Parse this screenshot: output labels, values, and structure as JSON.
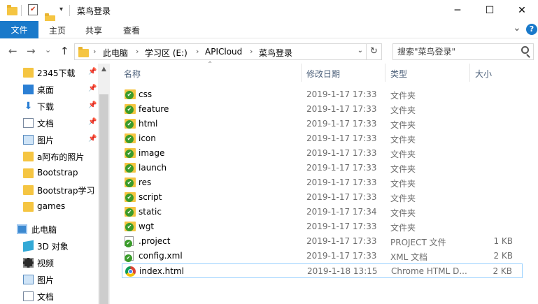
{
  "window": {
    "title": "菜鸟登录",
    "minimize": "─",
    "maximize": "☐",
    "close": "✕"
  },
  "ribbon": {
    "tabs": [
      "文件",
      "主页",
      "共享",
      "查看"
    ],
    "expand": "⌄",
    "help": "?"
  },
  "nav": {
    "back": "←",
    "forward": "→",
    "recent": "⌄",
    "up": "↑",
    "breadcrumbs": [
      "此电脑",
      "学习区 (E:)",
      "APICloud",
      "菜鸟登录"
    ],
    "search_placeholder": "搜索\"菜鸟登录\""
  },
  "sidebar": {
    "items": [
      {
        "label": "2345下载",
        "icon": "folder-icon",
        "pinned": true
      },
      {
        "label": "桌面",
        "icon": "desktop-icon",
        "pinned": true
      },
      {
        "label": "下载",
        "icon": "download-icon",
        "pinned": true
      },
      {
        "label": "文档",
        "icon": "document-icon",
        "pinned": true
      },
      {
        "label": "图片",
        "icon": "picture-icon",
        "pinned": true
      },
      {
        "label": "a阿布的照片",
        "icon": "folder-icon",
        "pinned": false
      },
      {
        "label": "Bootstrap",
        "icon": "folder-icon",
        "pinned": false
      },
      {
        "label": "Bootstrap学习",
        "icon": "folder-icon",
        "pinned": false
      },
      {
        "label": "games",
        "icon": "folder-icon",
        "pinned": false
      },
      {
        "label": "此电脑",
        "icon": "computer-icon",
        "pinned": false
      },
      {
        "label": "3D 对象",
        "icon": "3d-objects-icon",
        "pinned": false
      },
      {
        "label": "视频",
        "icon": "video-icon",
        "pinned": false
      },
      {
        "label": "图片",
        "icon": "picture-icon",
        "pinned": false
      },
      {
        "label": "文档",
        "icon": "document-icon",
        "pinned": false
      }
    ]
  },
  "filelist": {
    "columns": {
      "name": "名称",
      "date": "修改日期",
      "type": "类型",
      "size": "大小"
    },
    "rows": [
      {
        "name": "css",
        "date": "2019-1-17 17:33",
        "type": "文件夹",
        "size": "",
        "icon": "folder-synced-icon"
      },
      {
        "name": "feature",
        "date": "2019-1-17 17:33",
        "type": "文件夹",
        "size": "",
        "icon": "folder-synced-icon"
      },
      {
        "name": "html",
        "date": "2019-1-17 17:33",
        "type": "文件夹",
        "size": "",
        "icon": "folder-synced-icon"
      },
      {
        "name": "icon",
        "date": "2019-1-17 17:33",
        "type": "文件夹",
        "size": "",
        "icon": "folder-synced-icon"
      },
      {
        "name": "image",
        "date": "2019-1-17 17:33",
        "type": "文件夹",
        "size": "",
        "icon": "folder-synced-icon"
      },
      {
        "name": "launch",
        "date": "2019-1-17 17:33",
        "type": "文件夹",
        "size": "",
        "icon": "folder-synced-icon"
      },
      {
        "name": "res",
        "date": "2019-1-17 17:33",
        "type": "文件夹",
        "size": "",
        "icon": "folder-synced-icon"
      },
      {
        "name": "script",
        "date": "2019-1-17 17:33",
        "type": "文件夹",
        "size": "",
        "icon": "folder-synced-icon"
      },
      {
        "name": "static",
        "date": "2019-1-17 17:34",
        "type": "文件夹",
        "size": "",
        "icon": "folder-synced-icon"
      },
      {
        "name": "wgt",
        "date": "2019-1-17 17:33",
        "type": "文件夹",
        "size": "",
        "icon": "folder-synced-icon"
      },
      {
        "name": ".project",
        "date": "2019-1-17 17:33",
        "type": "PROJECT 文件",
        "size": "1 KB",
        "icon": "file-synced-icon"
      },
      {
        "name": "config.xml",
        "date": "2019-1-17 17:33",
        "type": "XML 文档",
        "size": "2 KB",
        "icon": "file-synced-icon"
      },
      {
        "name": "index.html",
        "date": "2019-1-18 13:15",
        "type": "Chrome HTML D...",
        "size": "2 KB",
        "icon": "chrome-html-icon",
        "selected": true
      }
    ]
  }
}
